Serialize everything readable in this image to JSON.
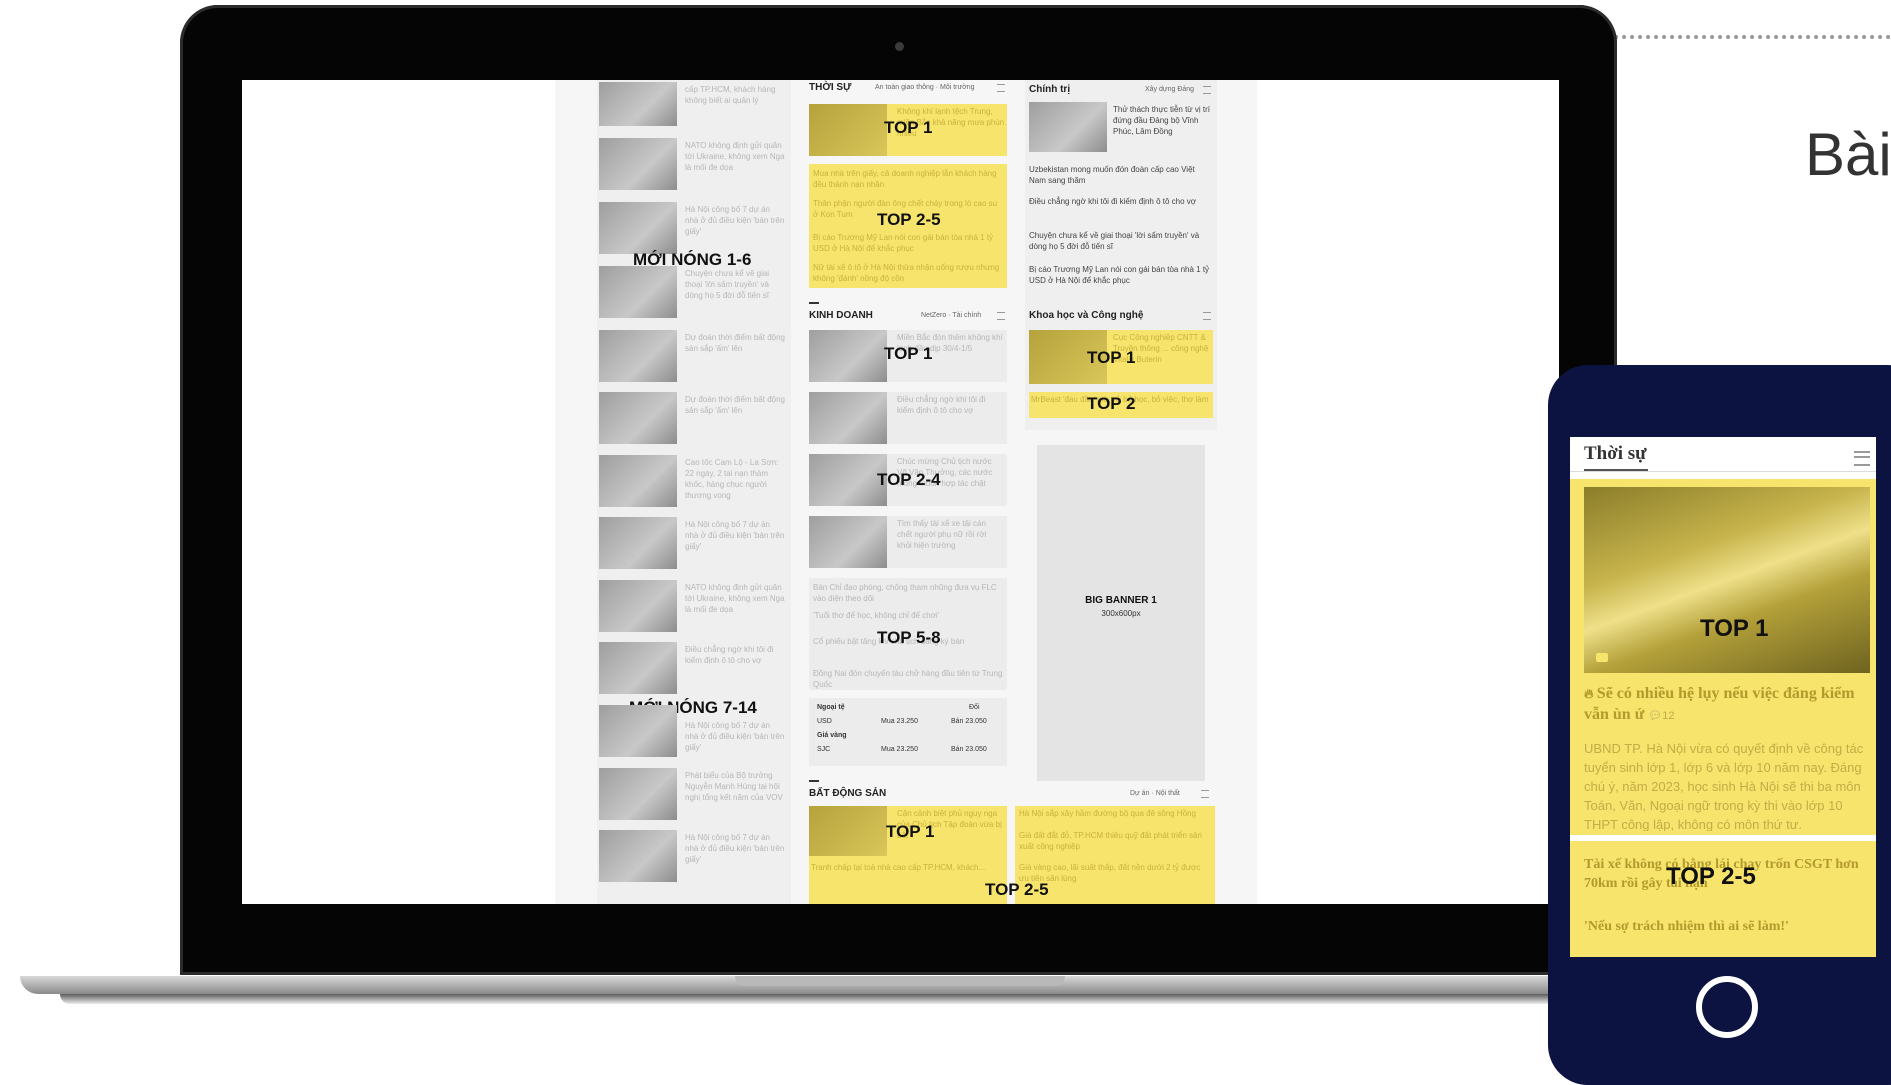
{
  "side_heading": "Bài",
  "page": {
    "col1": {
      "label_top": "MỚI NÓNG 1-6",
      "label_bottom": "MỚI NÓNG 7-14",
      "items": [
        "cấp TP.HCM, khách hàng không biết ai quản lý",
        "NATO không định gửi quân tới Ukraine, không xem Nga là mối đe dọa",
        "Hà Nội công bố 7 dự án nhà ở đủ điều kiện 'bán trên giấy'",
        "Chuyện chưa kể về giai thoại 'lời sấm truyền' và dòng họ 5 đời đỗ tiến sĩ",
        "Dự đoán thời điểm bất động sản sắp 'ấm' lên",
        "Dự đoán thời điểm bất động sản sắp 'ấm' lên",
        "Cao tốc Cam Lộ - La Sơn: 22 ngày, 2 tai nạn thảm khốc, hàng chục người thương vong",
        "Hà Nội công bố 7 dự án nhà ở đủ điều kiện 'bán trên giấy'",
        "NATO không định gửi quân tới Ukraine, không xem Nga là mối đe dọa",
        "Điều chẳng ngờ khi tôi đi kiếm định ô tô cho vợ",
        "Hà Nội công bố 7 dự án nhà ở đủ điều kiện 'bán trên giấy'",
        "Phát biểu của Bộ trưởng Nguyễn Mạnh Hùng tại hội nghị tổng kết năm của VOV",
        "Hà Nội công bố 7 dự án nhà ở đủ điều kiện 'bán trên giấy'"
      ]
    },
    "col2": {
      "thoisu_title": "THỜI SỰ",
      "thoisu_sub": "An toàn giao thông · Môi trường",
      "thoisu_top1_text": "Không khí lạnh tệch Trung, miền Bắc khả năng mưa phùn nhiều",
      "thoisu_top25_items": [
        "Mua nhà trên giấy, cả doanh nghiệp lẫn khách hàng đều thành nạn nhân",
        "Thân phận người đàn ông chết cháy trong lò cao su ở Kon Tum",
        "Bị cáo Trương Mỹ Lan nói con gái bán tòa nhà 1 tỷ USD ở Hà Nội để khắc phục",
        "Nữ tài xế ô tô ở Hà Nội thừa nhận uống rượu nhưng không 'đánh' nồng độ cồn"
      ],
      "top1": "TOP 1",
      "top25": "TOP 2-5",
      "kinhdoanh_title": "KINH DOANH",
      "kinhdoanh_sub": "NetZero · Tài chính",
      "kd_items": [
        "Miền Bắc đón thêm không khí lạnh đầu dịp 30/4-1/5",
        "Điều chẳng ngờ khi tôi đi kiểm định ô tô cho vợ",
        "Chúc mừng Chủ tịch nước Võ Văn Thưởng, các nước mong muốn hợp tác chặt",
        "Tìm thấy tài xế xe tải cán chết người phụ nữ rồi rời khỏi hiện trường"
      ],
      "kd_top1": "TOP 1",
      "kd_top24": "TOP 2-4",
      "kd_top58": "TOP 5-8",
      "kd_list": [
        "Bàn Chỉ đạo phòng, chống tham nhũng đưa vụ FLC vào diện theo dõi",
        "'Tuổi thơ để học, không chỉ để chơi'",
        "Cổ phiếu bật tăng khi chủ tịch đăng ký bán",
        "Đồng Nai đón chuyến tàu chở hàng đầu tiên từ Trung Quốc"
      ],
      "fx": {
        "ngoai_te": "Ngoại tệ",
        "doi": "Đổi",
        "usd": "USD",
        "usd_mua": "Mua 23.250",
        "usd_ban": "Bán 23.050",
        "gia_vang": "Giá vàng",
        "sjc": "SJC",
        "sjc_mua": "Mua 23.250",
        "sjc_ban": "Bán 23.050"
      },
      "bds_title": "BẤT ĐỘNG SẢN",
      "bds_sub": "Dự án · Nội thất",
      "bds_top1": "TOP 1",
      "bds_top25": "TOP 2-5",
      "bds_top1_text": "Cận cảnh biệt phủ nguy nga của Chủ tịch Tập đoàn vừa bị bắt",
      "bds_list": [
        "Hà Nội sắp xây hầm đường bộ qua đê sông Hồng",
        "Giá đất đắt đỏ, TP.HCM thiếu quỹ đất phát triển sản xuất công nghiệp",
        "Giá vàng cao, lãi suất thấp, đất nền dưới 2 tỷ được ưu tiên săn lùng"
      ],
      "bds_bottom": "Tranh chấp tại toà nhà cao cấp TP.HCM, khách..."
    },
    "col3": {
      "chinhtri_title": "Chính trị",
      "chinhtri_sub": "Xây dựng Đảng",
      "chinhtri_lead": "Thử thách thực tiễn từ vị trí đứng đầu Đảng bộ Vĩnh Phúc, Lâm Đồng",
      "chinhtri_list": [
        "Uzbekistan mong muốn đón đoàn cấp cao Việt Nam sang thăm",
        "Điều chẳng ngờ khi tôi đi kiếm định ô tô cho vợ",
        "Chuyện chưa kể về giai thoại 'lời sấm truyền' và dòng họ 5 đời đỗ tiến sĩ",
        "Bị cáo Trương Mỹ Lan nói con gái bán tòa nhà 1 tỷ USD ở Hà Nội để khắc phục"
      ],
      "khcn_title": "Khoa học và Công nghệ",
      "khcn_top1": "TOP 1",
      "khcn_top2": "TOP 2",
      "khcn_top1_text": "Cục Công nghiệp CNTT & Truyền thông ... công nghệ Vitalik Buterin",
      "khcn_top2_text": "MrBeast 'đau đầu' giờ trở bỏ học, bỏ việc, thơ làm",
      "banner_title": "BIG BANNER 1",
      "banner_size": "300x600px"
    }
  },
  "phone": {
    "section_title": "Thời sự",
    "top1": "TOP 1",
    "headline": "Sẽ có nhiều hệ lụy nếu việc đăng kiểm vẫn ùn ứ",
    "comment_count": "12",
    "body": "UBND TP. Hà Nội vừa có quyết định về công tác tuyển sinh lớp 1, lớp 6 và lớp 10 năm nay. Đáng chú ý, năm 2023, học sinh Hà Nội sẽ thi ba môn Toán, Văn, Ngoại ngữ trong kỳ thi vào lớp 10 THPT công lập, không có môn thứ tư.",
    "item2": "Tài xế không có bằng lái chạy trốn CSGT hơn 70km rồi gây tai nạn",
    "top25": "TOP 2-5",
    "item3": "'Nếu sợ trách nhiệm thì ai sẽ làm!'"
  },
  "colors": {
    "highlight": "#f6e46c",
    "phone_body": "#0c1340",
    "bezel": "#050505"
  }
}
